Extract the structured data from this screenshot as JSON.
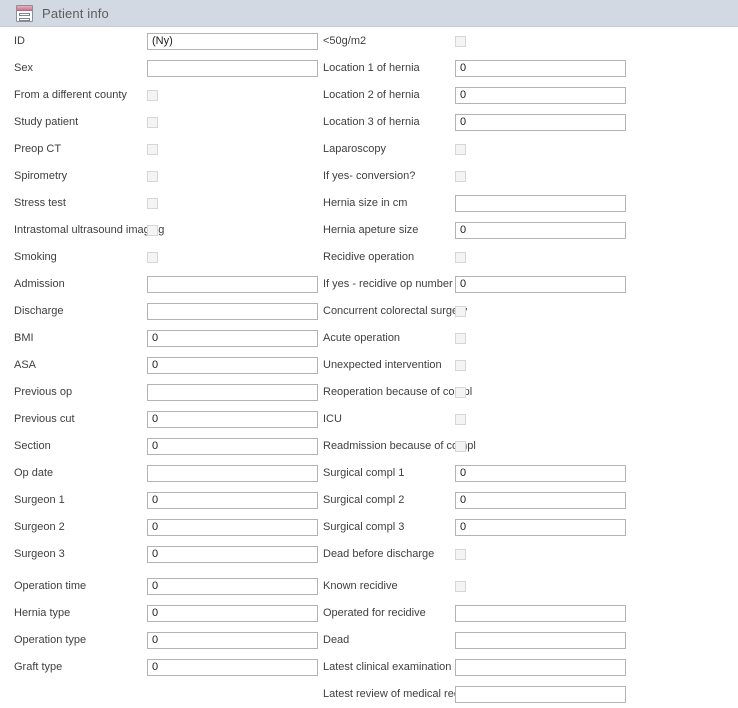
{
  "header": {
    "title": "Patient info",
    "icon": "form-table-icon",
    "background_color": "#d3d9e2",
    "title_color": "#5d5d5d"
  },
  "theme": {
    "checkbox_fill": "#2d7ba6",
    "input_border": "#b3b3b3",
    "label_color": "#3f3f3f",
    "page_background": "#ffffff"
  },
  "left_column": [
    {
      "label": "ID",
      "control": "text",
      "value": "(Ny)"
    },
    {
      "label": "Sex",
      "control": "text",
      "value": ""
    },
    {
      "label": "From a different county",
      "control": "checkbox",
      "value": ""
    },
    {
      "label": "Study patient",
      "control": "checkbox",
      "value": ""
    },
    {
      "label": "Preop CT",
      "control": "checkbox",
      "value": ""
    },
    {
      "label": "Spirometry",
      "control": "checkbox",
      "value": ""
    },
    {
      "label": "Stress test",
      "control": "checkbox",
      "value": ""
    },
    {
      "label": "Intrastomal ultrasound imaging",
      "control": "checkbox",
      "value": ""
    },
    {
      "label": "Smoking",
      "control": "checkbox",
      "value": ""
    },
    {
      "label": "Admission",
      "control": "text",
      "value": ""
    },
    {
      "label": "Discharge",
      "control": "text",
      "value": ""
    },
    {
      "label": "BMI",
      "control": "text",
      "value": "0"
    },
    {
      "label": "ASA",
      "control": "text",
      "value": "0"
    },
    {
      "label": "Previous op",
      "control": "text",
      "value": ""
    },
    {
      "label": "Previous cut",
      "control": "text",
      "value": "0"
    },
    {
      "label": "Section",
      "control": "text",
      "value": "0"
    },
    {
      "label": "Op date",
      "control": "text",
      "value": ""
    },
    {
      "label": "Surgeon 1",
      "control": "text",
      "value": "0"
    },
    {
      "label": "Surgeon 2",
      "control": "text",
      "value": "0"
    },
    {
      "label": "Surgeon 3",
      "control": "text",
      "value": "0"
    },
    {
      "label": "Operation time",
      "control": "text",
      "value": "0",
      "gap_before": true
    },
    {
      "label": "Hernia type",
      "control": "text",
      "value": "0"
    },
    {
      "label": "Operation type",
      "control": "text",
      "value": "0"
    },
    {
      "label": "Graft type",
      "control": "text",
      "value": "0"
    }
  ],
  "right_column": [
    {
      "label": "<50g/m2",
      "control": "checkbox",
      "value": ""
    },
    {
      "label": "Location 1 of hernia",
      "control": "text",
      "value": "0"
    },
    {
      "label": "Location 2 of hernia",
      "control": "text",
      "value": "0"
    },
    {
      "label": "Location 3 of hernia",
      "control": "text",
      "value": "0"
    },
    {
      "label": "Laparoscopy",
      "control": "checkbox",
      "value": ""
    },
    {
      "label": "If yes- conversion?",
      "control": "checkbox",
      "value": ""
    },
    {
      "label": "Hernia size in cm",
      "control": "text",
      "value": ""
    },
    {
      "label": "Hernia apeture size",
      "control": "text",
      "value": "0"
    },
    {
      "label": "Recidive operation",
      "control": "checkbox",
      "value": ""
    },
    {
      "label": "If yes - recidive op number",
      "control": "text",
      "value": "0"
    },
    {
      "label": "Concurrent colorectal surgery",
      "control": "checkbox",
      "value": ""
    },
    {
      "label": "Acute operation",
      "control": "checkbox",
      "value": ""
    },
    {
      "label": "Unexpected intervention",
      "control": "checkbox",
      "value": ""
    },
    {
      "label": "Reoperation because of compl",
      "control": "checkbox",
      "value": ""
    },
    {
      "label": "ICU",
      "control": "checkbox",
      "value": ""
    },
    {
      "label": "Readmission because of compl",
      "control": "checkbox",
      "value": ""
    },
    {
      "label": "Surgical compl 1",
      "control": "text",
      "value": "0"
    },
    {
      "label": "Surgical compl 2",
      "control": "text",
      "value": "0"
    },
    {
      "label": "Surgical compl 3",
      "control": "text",
      "value": "0"
    },
    {
      "label": "Dead before discharge",
      "control": "checkbox",
      "value": ""
    },
    {
      "label": "Known recidive",
      "control": "checkbox",
      "value": "",
      "gap_before": true
    },
    {
      "label": "Operated for recidive",
      "control": "text",
      "value": ""
    },
    {
      "label": "Dead",
      "control": "text",
      "value": ""
    },
    {
      "label": "Latest clinical examination",
      "control": "text",
      "value": ""
    },
    {
      "label": "Latest review of medical record",
      "control": "text",
      "value": ""
    }
  ]
}
